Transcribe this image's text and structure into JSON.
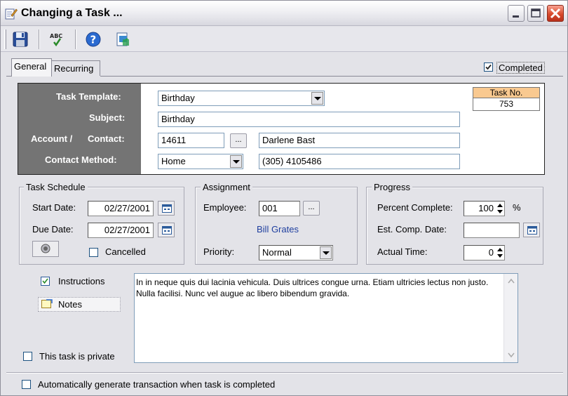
{
  "window": {
    "title": "Changing a Task ..."
  },
  "toolbar": {
    "buttons": [
      {
        "name": "save",
        "icon": "floppy-disk-icon"
      },
      {
        "name": "spell-check",
        "icon": "spell-check-icon",
        "label": "ABC"
      },
      {
        "name": "help",
        "icon": "help-icon"
      },
      {
        "name": "export",
        "icon": "export-icon"
      }
    ]
  },
  "tabs": {
    "general": "General",
    "recurring": "Recurring"
  },
  "completed": {
    "label": "Completed",
    "checked": true
  },
  "header": {
    "task_template_label": "Task Template:",
    "task_template_value": "Birthday",
    "subject_label": "Subject:",
    "subject_value": "Birthday",
    "account_label": "Account /",
    "contact_label": "Contact:",
    "account_value": "14611",
    "contact_value": "Darlene Bast",
    "contact_method_label": "Contact Method:",
    "contact_method_value": "Home",
    "phone_value": "(305) 4105486",
    "dots_label": "...",
    "task_no_label": "Task No.",
    "task_no_value": "753"
  },
  "schedule": {
    "title": "Task Schedule",
    "start_label": "Start Date:",
    "start_value": "02/27/2001",
    "due_label": "Due Date:",
    "due_value": "02/27/2001",
    "cancelled_label": "Cancelled",
    "cancelled_checked": false
  },
  "assignment": {
    "title": "Assignment",
    "employee_label": "Employee:",
    "employee_value": "001",
    "employee_name": "Bill Grates",
    "priority_label": "Priority:",
    "priority_value": "Normal"
  },
  "progress": {
    "title": "Progress",
    "percent_label": "Percent Complete:",
    "percent_value": "100",
    "percent_unit": "%",
    "est_label": "Est. Comp. Date:",
    "est_value": "",
    "actual_label": "Actual Time:",
    "actual_value": "0"
  },
  "side": {
    "instructions": "Instructions",
    "notes": "Notes"
  },
  "notes_text": "In in neque quis dui lacinia vehicula. Duis ultrices congue urna. Etiam ultricies lectus non justo. Nulla facilisi. Nunc vel augue ac libero bibendum gravida.",
  "private": {
    "label": "This task is private",
    "checked": false
  },
  "auto_generate": {
    "label": "Automatically generate transaction when task is completed",
    "checked": false
  },
  "colors": {
    "header_panel": "#747474",
    "task_no_head": "#f9c990",
    "employee_name": "#1f3f9f"
  }
}
